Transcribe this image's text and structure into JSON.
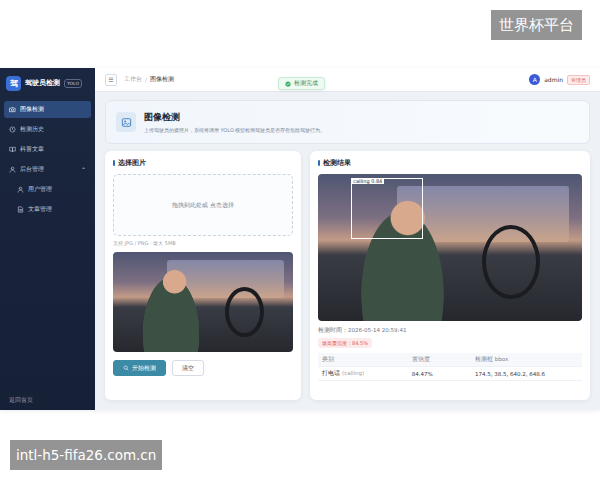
{
  "watermarks": [
    "世界杯平台",
    "intl-h5-fifa26.com.cn"
  ],
  "sidebar": {
    "logo": "驾",
    "title": "驾驶员检测",
    "badge": "YOLO",
    "items": [
      {
        "label": "图像检测",
        "kind": "item",
        "selected": true
      },
      {
        "label": "检测历史",
        "kind": "item",
        "selected": false
      },
      {
        "label": "科普文章",
        "kind": "item",
        "selected": false
      },
      {
        "label": "后台管理",
        "kind": "group",
        "selected": false,
        "expanded": true,
        "arrow": "⌃"
      },
      {
        "label": "用户管理",
        "kind": "subitem",
        "selected": false
      },
      {
        "label": "文章管理",
        "kind": "subitem",
        "selected": false
      }
    ],
    "footer": "返回首页"
  },
  "topbar": {
    "menu_icon": "☰",
    "breadcrumb": [
      "工作台",
      "图像检测"
    ],
    "separator": "/",
    "user": {
      "avatar": "A",
      "name": "admin",
      "role": "管理员"
    }
  },
  "toast": {
    "text": "检测完成"
  },
  "header": {
    "title": "图像检测",
    "subtitle": "上传驾驶员拍摄照片，系统将调用 YOLO 模型检测驾驶员是否存在危险驾驶行为。"
  },
  "upload": {
    "title": "选择图片",
    "dropzone": "拖拽到此处或 点击选择",
    "hint": "支持 JPG / PNG · 最大 5MB",
    "buttons": [
      {
        "label": "开始检测",
        "kind": "primary"
      },
      {
        "label": "清空",
        "kind": "plain"
      }
    ]
  },
  "result": {
    "title": "检测结果",
    "box_label": "calling 0.84",
    "time": "检测时间：2026-05-14 20:59:41",
    "top_tag": "最高置信度：84.5%",
    "table": {
      "columns": [
        "类别",
        "置信度",
        "检测框 bbox"
      ],
      "rows": [
        {
          "class": "打电话",
          "class_en": "(calling)",
          "confidence": "84.47%",
          "bbox": "174.5, 38.5, 640.2, 648.6"
        }
      ]
    }
  }
}
